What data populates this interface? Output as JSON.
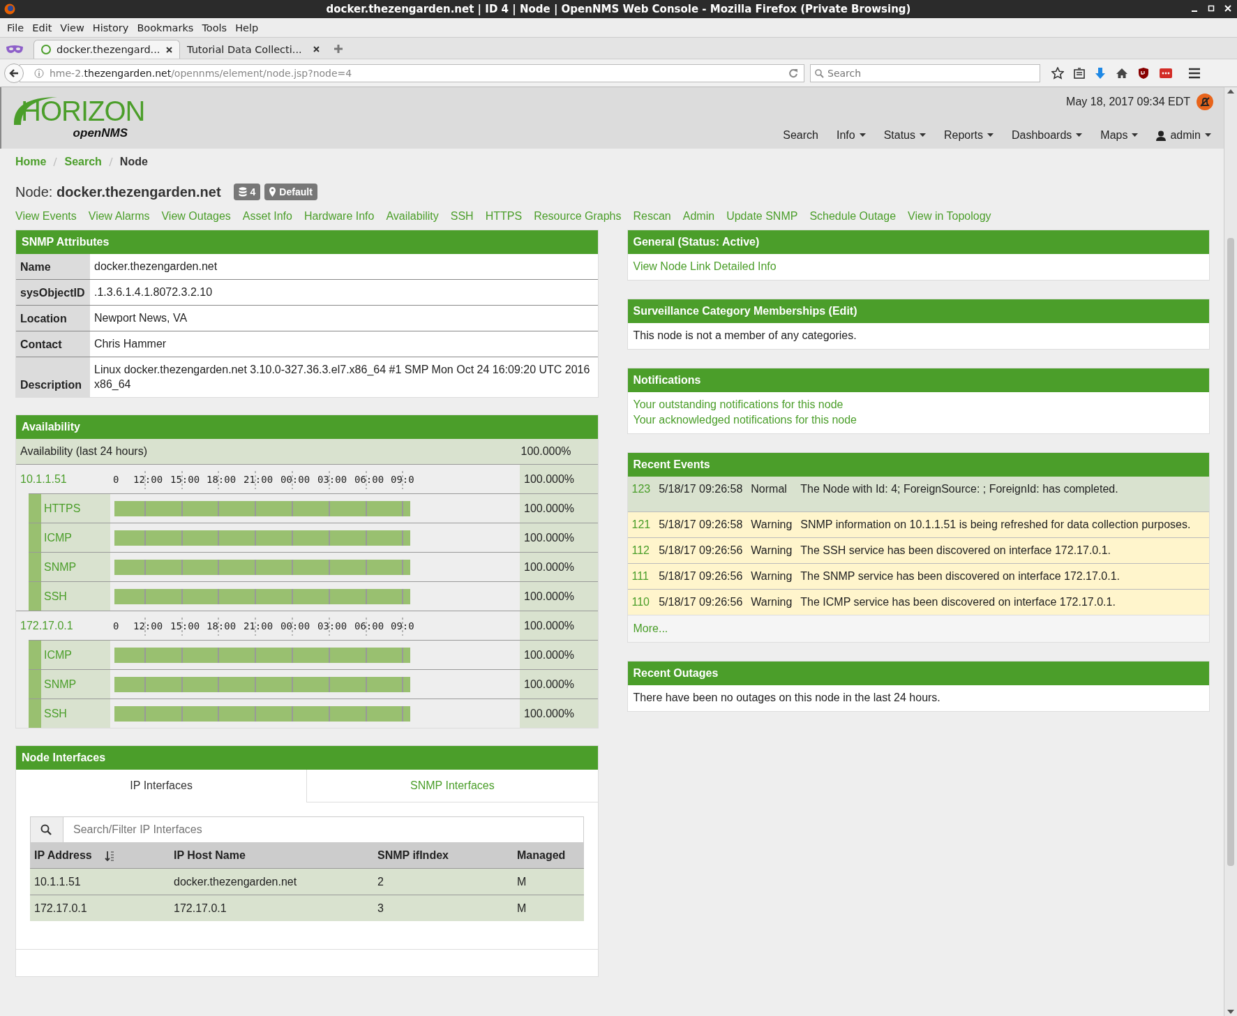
{
  "browser": {
    "window_title": "docker.thezengarden.net | ID 4 | Node | OpenNMS Web Console - Mozilla Firefox (Private Browsing)",
    "menu": [
      "File",
      "Edit",
      "View",
      "History",
      "Bookmarks",
      "Tools",
      "Help"
    ],
    "tabs": [
      {
        "label": "docker.thezengard...",
        "selected": true
      },
      {
        "label": "Tutorial Data Collecti...",
        "selected": false
      }
    ],
    "url": {
      "prefix": "hme-2.",
      "domain": "thezengarden.net",
      "path": "/opennms/element/node.jsp?node=4"
    },
    "search_placeholder": "Search"
  },
  "header": {
    "logo": "HORIZON",
    "logo_sub": "openNMS",
    "datetime": "May 18, 2017 09:34 EDT",
    "nav": [
      {
        "label": "Search",
        "kind": "plain"
      },
      {
        "label": "Info",
        "kind": "dropdown"
      },
      {
        "label": "Status",
        "kind": "dropdown"
      },
      {
        "label": "Reports",
        "kind": "dropdown"
      },
      {
        "label": "Dashboards",
        "kind": "dropdown"
      },
      {
        "label": "Maps",
        "kind": "dropdown"
      },
      {
        "label": "admin",
        "kind": "user"
      }
    ]
  },
  "breadcrumb": [
    {
      "label": "Home",
      "kind": "link"
    },
    {
      "label": "Search",
      "kind": "link"
    },
    {
      "label": "Node",
      "kind": "current"
    }
  ],
  "node": {
    "label": "Node:",
    "name": "docker.thezengarden.net",
    "badges": [
      {
        "kind": "database",
        "text": "4"
      },
      {
        "kind": "location",
        "text": "Default"
      }
    ]
  },
  "links": [
    "View Events",
    "View Alarms",
    "View Outages",
    "Asset Info",
    "Hardware Info",
    "Availability",
    "SSH",
    "HTTPS",
    "Resource Graphs",
    "Rescan",
    "Admin",
    "Update SNMP",
    "Schedule Outage",
    "View in Topology"
  ],
  "snmp_attributes": {
    "title": "SNMP Attributes",
    "rows": [
      {
        "label": "Name",
        "value": "docker.thezengarden.net"
      },
      {
        "label": "sysObjectID",
        "value": ".1.3.6.1.4.1.8072.3.2.10"
      },
      {
        "label": "Location",
        "value": "Newport News, VA"
      },
      {
        "label": "Contact",
        "value": "Chris Hammer"
      },
      {
        "label": "Description",
        "value": "Linux docker.thezengarden.net 3.10.0-327.36.3.el7.x86_64 #1 SMP Mon Oct 24 16:09:20 UTC 2016 x86_64"
      }
    ]
  },
  "availability": {
    "title": "Availability",
    "summary_label": "Availability (last 24 hours)",
    "summary_value": "100.000%",
    "interfaces": [
      {
        "address": "10.1.1.51",
        "value": "100.000%",
        "timeline": [
          "0",
          "12:00",
          "15:00",
          "18:00",
          "21:00",
          "00:00",
          "03:00",
          "06:00",
          "09:0"
        ],
        "services": [
          {
            "name": "HTTPS",
            "value": "100.000%"
          },
          {
            "name": "ICMP",
            "value": "100.000%"
          },
          {
            "name": "SNMP",
            "value": "100.000%"
          },
          {
            "name": "SSH",
            "value": "100.000%"
          }
        ]
      },
      {
        "address": "172.17.0.1",
        "value": "100.000%",
        "timeline": [
          "0",
          "12:00",
          "15:00",
          "18:00",
          "21:00",
          "00:00",
          "03:00",
          "06:00",
          "09:0"
        ],
        "services": [
          {
            "name": "ICMP",
            "value": "100.000%"
          },
          {
            "name": "SNMP",
            "value": "100.000%"
          },
          {
            "name": "SSH",
            "value": "100.000%"
          }
        ]
      }
    ]
  },
  "node_interfaces": {
    "title": "Node Interfaces",
    "tabs": [
      {
        "label": "IP Interfaces",
        "selected": true
      },
      {
        "label": "SNMP Interfaces",
        "selected": false
      }
    ],
    "filter_placeholder": "Search/Filter IP Interfaces",
    "columns": [
      "IP Address",
      "IP Host Name",
      "SNMP ifIndex",
      "Managed"
    ],
    "rows": [
      [
        "10.1.1.51",
        "docker.thezengarden.net",
        "2",
        "M"
      ],
      [
        "172.17.0.1",
        "172.17.0.1",
        "3",
        "M"
      ]
    ]
  },
  "general": {
    "title": "General (Status: Active)",
    "link": "View Node Link Detailed Info"
  },
  "surveillance": {
    "title": "Surveillance Category Memberships (Edit)",
    "text": "This node is not a member of any categories."
  },
  "notifications": {
    "title": "Notifications",
    "links": [
      "Your outstanding notifications for this node",
      "Your acknowledged notifications for this node"
    ]
  },
  "recent_events": {
    "title": "Recent Events",
    "events": [
      {
        "id": "123",
        "time": "5/18/17 09:26:58",
        "kind": "normal",
        "severity": "Normal",
        "message": "The Node with Id: 4; ForeignSource: ; ForeignId: has completed."
      },
      {
        "id": "121",
        "time": "5/18/17 09:26:58",
        "kind": "warning",
        "severity": "Warning",
        "message": "SNMP information on 10.1.1.51 is being refreshed for data collection purposes."
      },
      {
        "id": "112",
        "time": "5/18/17 09:26:56",
        "kind": "warning",
        "severity": "Warning",
        "message": "The SSH service has been discovered on interface 172.17.0.1."
      },
      {
        "id": "111",
        "time": "5/18/17 09:26:56",
        "kind": "warning",
        "severity": "Warning",
        "message": "The SNMP service has been discovered on interface 172.17.0.1."
      },
      {
        "id": "110",
        "time": "5/18/17 09:26:56",
        "kind": "warning",
        "severity": "Warning",
        "message": "The ICMP service has been discovered on interface 172.17.0.1."
      }
    ],
    "more": "More..."
  },
  "recent_outages": {
    "title": "Recent Outages",
    "text": "There have been no outages on this node in the last 24 hours."
  }
}
